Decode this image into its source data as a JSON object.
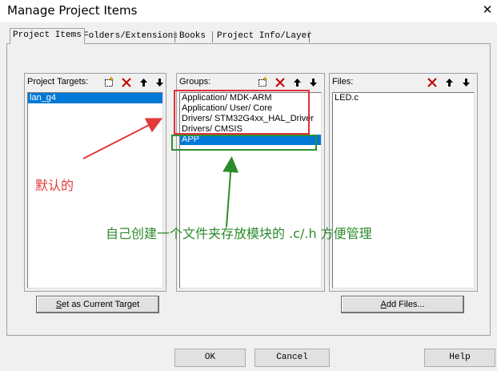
{
  "window": {
    "title": "Manage Project Items",
    "close_glyph": "✕"
  },
  "tabs": [
    {
      "label": "Project Items",
      "active": true
    },
    {
      "label": "Folders/Extensions",
      "active": false
    },
    {
      "label": "Books",
      "active": false
    },
    {
      "label": "Project Info/Layer",
      "active": false
    }
  ],
  "targets": {
    "label": "Project Targets:",
    "items": [
      "lan_g4"
    ],
    "selected_index": 0,
    "toolbar_icons": [
      "new-item-icon",
      "delete-icon",
      "move-up-icon",
      "move-down-icon"
    ],
    "button": "Set as Current Target",
    "button_hotkey": "S"
  },
  "groups": {
    "label": "Groups:",
    "items": [
      "Application/ MDK-ARM",
      "Application/ User/ Core",
      "Drivers/ STM32G4xx_HAL_Driver",
      "Drivers/ CMSIS",
      "APP"
    ],
    "selected_index": 4,
    "toolbar_icons": [
      "new-item-icon",
      "delete-icon",
      "move-up-icon",
      "move-down-icon"
    ]
  },
  "files": {
    "label": "Files:",
    "items": [
      "LED.c"
    ],
    "toolbar_icons": [
      "delete-icon",
      "move-up-icon",
      "move-down-icon"
    ],
    "button": "Add Files...",
    "button_hotkey": "A"
  },
  "footer": {
    "ok": "OK",
    "cancel": "Cancel",
    "help": "Help"
  },
  "annotations": {
    "red_note": "默认的",
    "green_note": "自己创建一个文件夹存放模块的 .c/.h 方便管理",
    "red_color": "#e0303a",
    "green_color": "#2f8f2f"
  },
  "colors": {
    "selection": "#0078d7",
    "dialog_bg": "#f0f0f0"
  }
}
